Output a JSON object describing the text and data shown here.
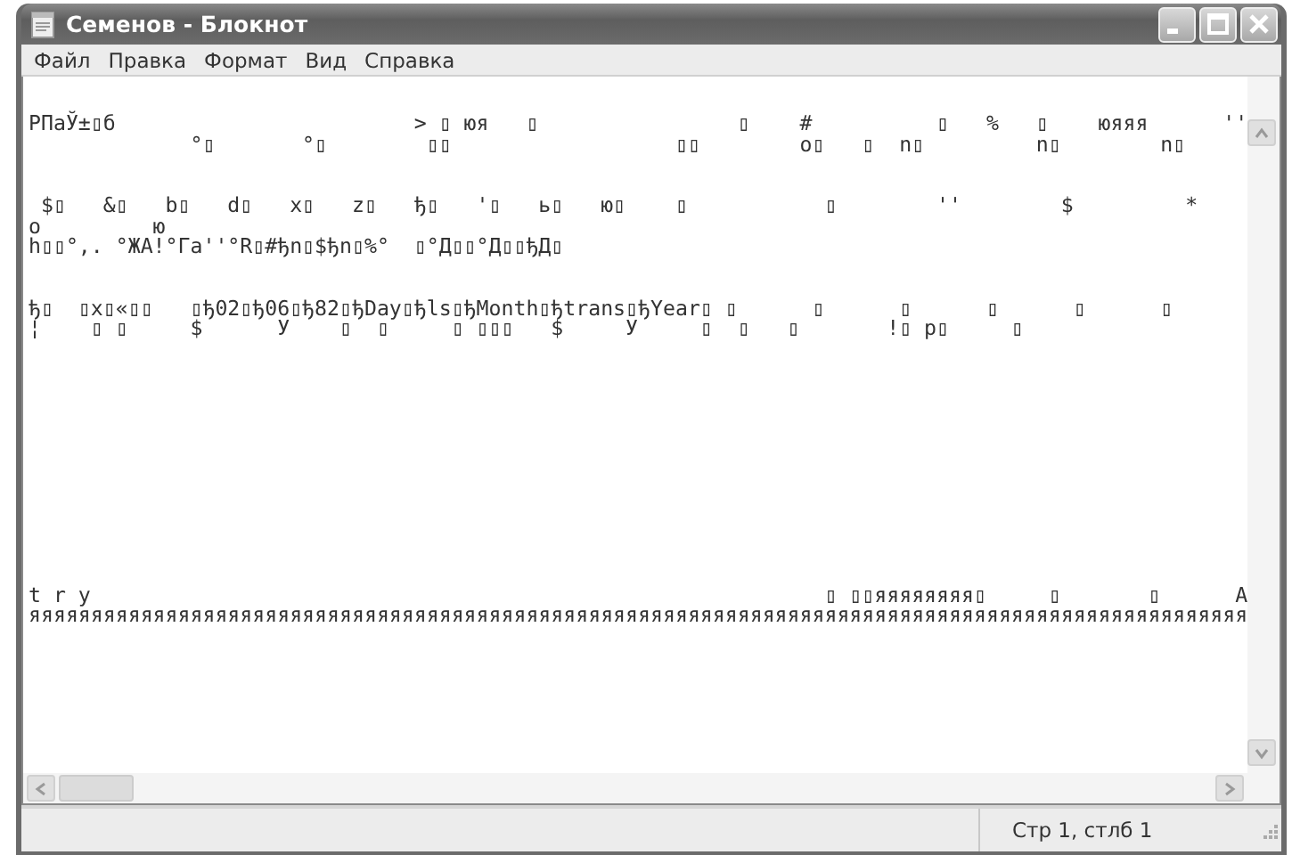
{
  "window": {
    "title": "Семенов - Блокнот"
  },
  "menu": [
    {
      "label": "Файл"
    },
    {
      "label": "Правка"
    },
    {
      "label": "Формат"
    },
    {
      "label": "Вид"
    },
    {
      "label": "Справка"
    }
  ],
  "editor": {
    "text": "РПаЎ±▯б                        > ▯ юя   ▯                ▯    #          ▯   %   ▯    юяяя      ''\n             °▯       °▯        ▯▯                  ▯▯        o▯   ▯  n▯         n▯        n▯\n\n\n $▯   &▯   b▯   d▯   x▯   z▯   ђ▯   '▯   ь▯   ю▯    ▯           ▯        ''        $         *\no         ю\nh▯▯°,. °ЖA!°Гa''°R▯#ђn▯$ђn▯%°  ▯°Д▯▯°Д▯▯ђД▯\n\n\nђ▯  ▯x▯«▯▯   ▯ђ02▯ђ06▯ђ82▯ђDay▯ђls▯ђMonth▯ђtrans▯ђYear▯ ▯      ▯      ▯      ▯      ▯      ▯\n¦    ▯ ▯     $      У    ▯  ▯     ▯ ▯▯▯   $     У     ▯  ▯   ▯       !▯ р▯     ▯\n\n\n\n\n\n\n\n\n\n\n\n\nt r y                                                           ▯ ▯▯яяяяяяяя▯     ▯       ▯      A\nяяяяяяяяяяяяяяяяяяяяяяяяяяяяяяяяяяяяяяяяяяяяяяяяяяяяяяяяяяяяяяяяяяяяяяяяяяяяяяяяяяяяяяяяяяяяяяяяяя"
  },
  "status_bar": {
    "position": "Стр 1, стлб 1"
  }
}
